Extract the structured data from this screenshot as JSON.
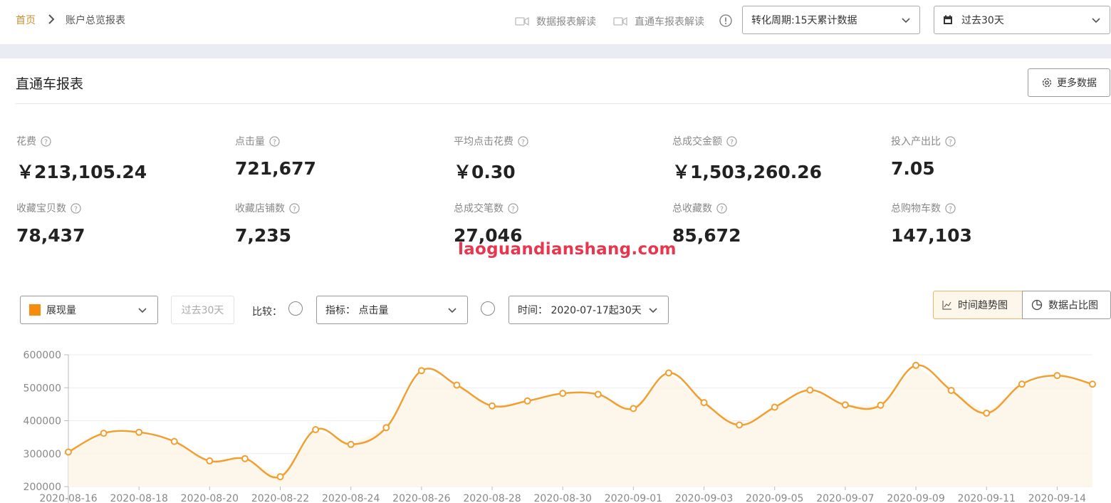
{
  "breadcrumb": {
    "home": "首页",
    "current": "账户总览报表"
  },
  "header": {
    "link_data_report": "数据报表解读",
    "link_ztc_report": "直通车报表解读",
    "conversion_select": "转化周期:15天累计数据",
    "date_select": "过去30天"
  },
  "card": {
    "title": "直通车报表",
    "more_button": "更多数据"
  },
  "metrics": [
    {
      "label": "花费",
      "value": "￥213,105.24"
    },
    {
      "label": "点击量",
      "value": "721,677"
    },
    {
      "label": "平均点击花费",
      "value": "￥0.30"
    },
    {
      "label": "总成交金额",
      "value": "￥1,503,260.26"
    },
    {
      "label": "投入产出比",
      "value": "7.05"
    },
    {
      "label": "收藏宝贝数",
      "value": "78,437"
    },
    {
      "label": "收藏店铺数",
      "value": "7,235"
    },
    {
      "label": "总成交笔数",
      "value": "27,046"
    },
    {
      "label": "总收藏数",
      "value": "85,672"
    },
    {
      "label": "总购物车数",
      "value": "147,103"
    }
  ],
  "watermark": "laoguandianshang.com",
  "controls": {
    "metric_select": "展现量",
    "period_disabled": "过去30天",
    "compare_label": "比较：",
    "indicator_select": "指标： 点击量",
    "time_select": "时间： 2020-07-17起30天",
    "tab_trend": "时间趋势图",
    "tab_share": "数据占比图"
  },
  "colors": {
    "accent": "#f0a032",
    "swatch": "#f78b0c",
    "brand_link": "#c8902f",
    "watermark": "#e8364f"
  },
  "chart_data": {
    "type": "area",
    "y_ticks": [
      "600000",
      "500000",
      "400000",
      "300000",
      "200000"
    ],
    "x_tick_labels": [
      "2020-08-16",
      "2020-08-18",
      "2020-08-20",
      "2020-08-22",
      "2020-08-24",
      "2020-08-26",
      "2020-08-28",
      "2020-08-30",
      "2020-09-01",
      "2020-09-03",
      "2020-09-05",
      "2020-09-07",
      "2020-09-09",
      "2020-09-11",
      "2020-09-14"
    ],
    "ylim": [
      200000,
      600000
    ],
    "series": [
      {
        "values": [
          305000,
          362000,
          365000,
          337000,
          278000,
          285000,
          230000,
          373000,
          328000,
          379000,
          552000,
          508000,
          445000,
          460000,
          483000,
          480000,
          437000,
          545000,
          455000,
          387000,
          441000,
          493000,
          448000,
          447000,
          568000,
          492000,
          423000,
          511000,
          537000,
          511000
        ]
      }
    ],
    "grid": true
  }
}
